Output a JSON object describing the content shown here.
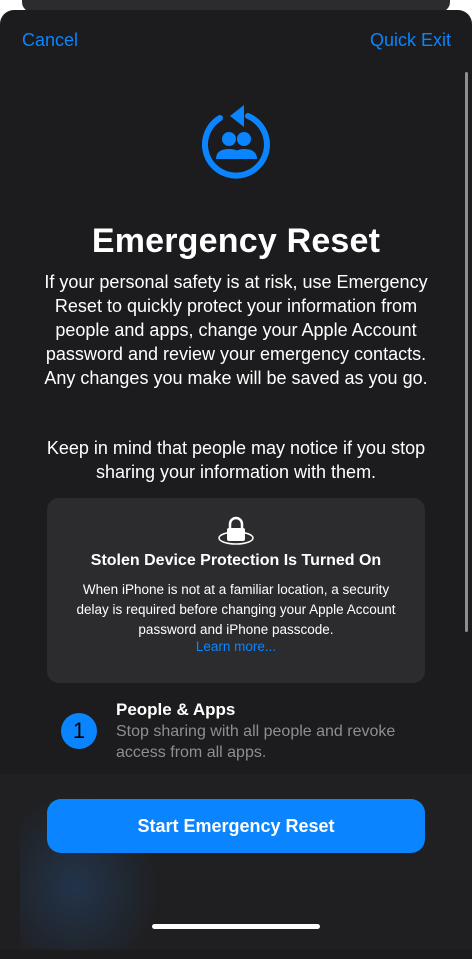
{
  "nav": {
    "cancel_label": "Cancel",
    "quick_exit_label": "Quick Exit"
  },
  "hero": {
    "icon": "people-reset-icon",
    "title": "Emergency Reset",
    "paragraph1": "If your personal safety is at risk, use Emergency Reset to quickly protect your information from people and apps, change your Apple Account password and review your emergency contacts. Any changes you make will be saved as you go.",
    "paragraph2": "Keep in mind that people may notice if you stop sharing your information with them."
  },
  "card": {
    "icon": "lock-icon",
    "title": "Stolen Device Protection Is Turned On",
    "text": "When iPhone is not at a familiar location, a security delay is required before changing your Apple Account password and iPhone passcode.",
    "link": "Learn more..."
  },
  "step": {
    "number": "1",
    "title": "People & Apps",
    "description": "Stop sharing with all people and revoke access from all apps."
  },
  "footer": {
    "primary_label": "Start Emergency Reset"
  },
  "colors": {
    "accent": "#0a84ff",
    "background": "#1c1c1e",
    "card": "#2c2c2e",
    "secondary_text": "#8e8e93"
  }
}
